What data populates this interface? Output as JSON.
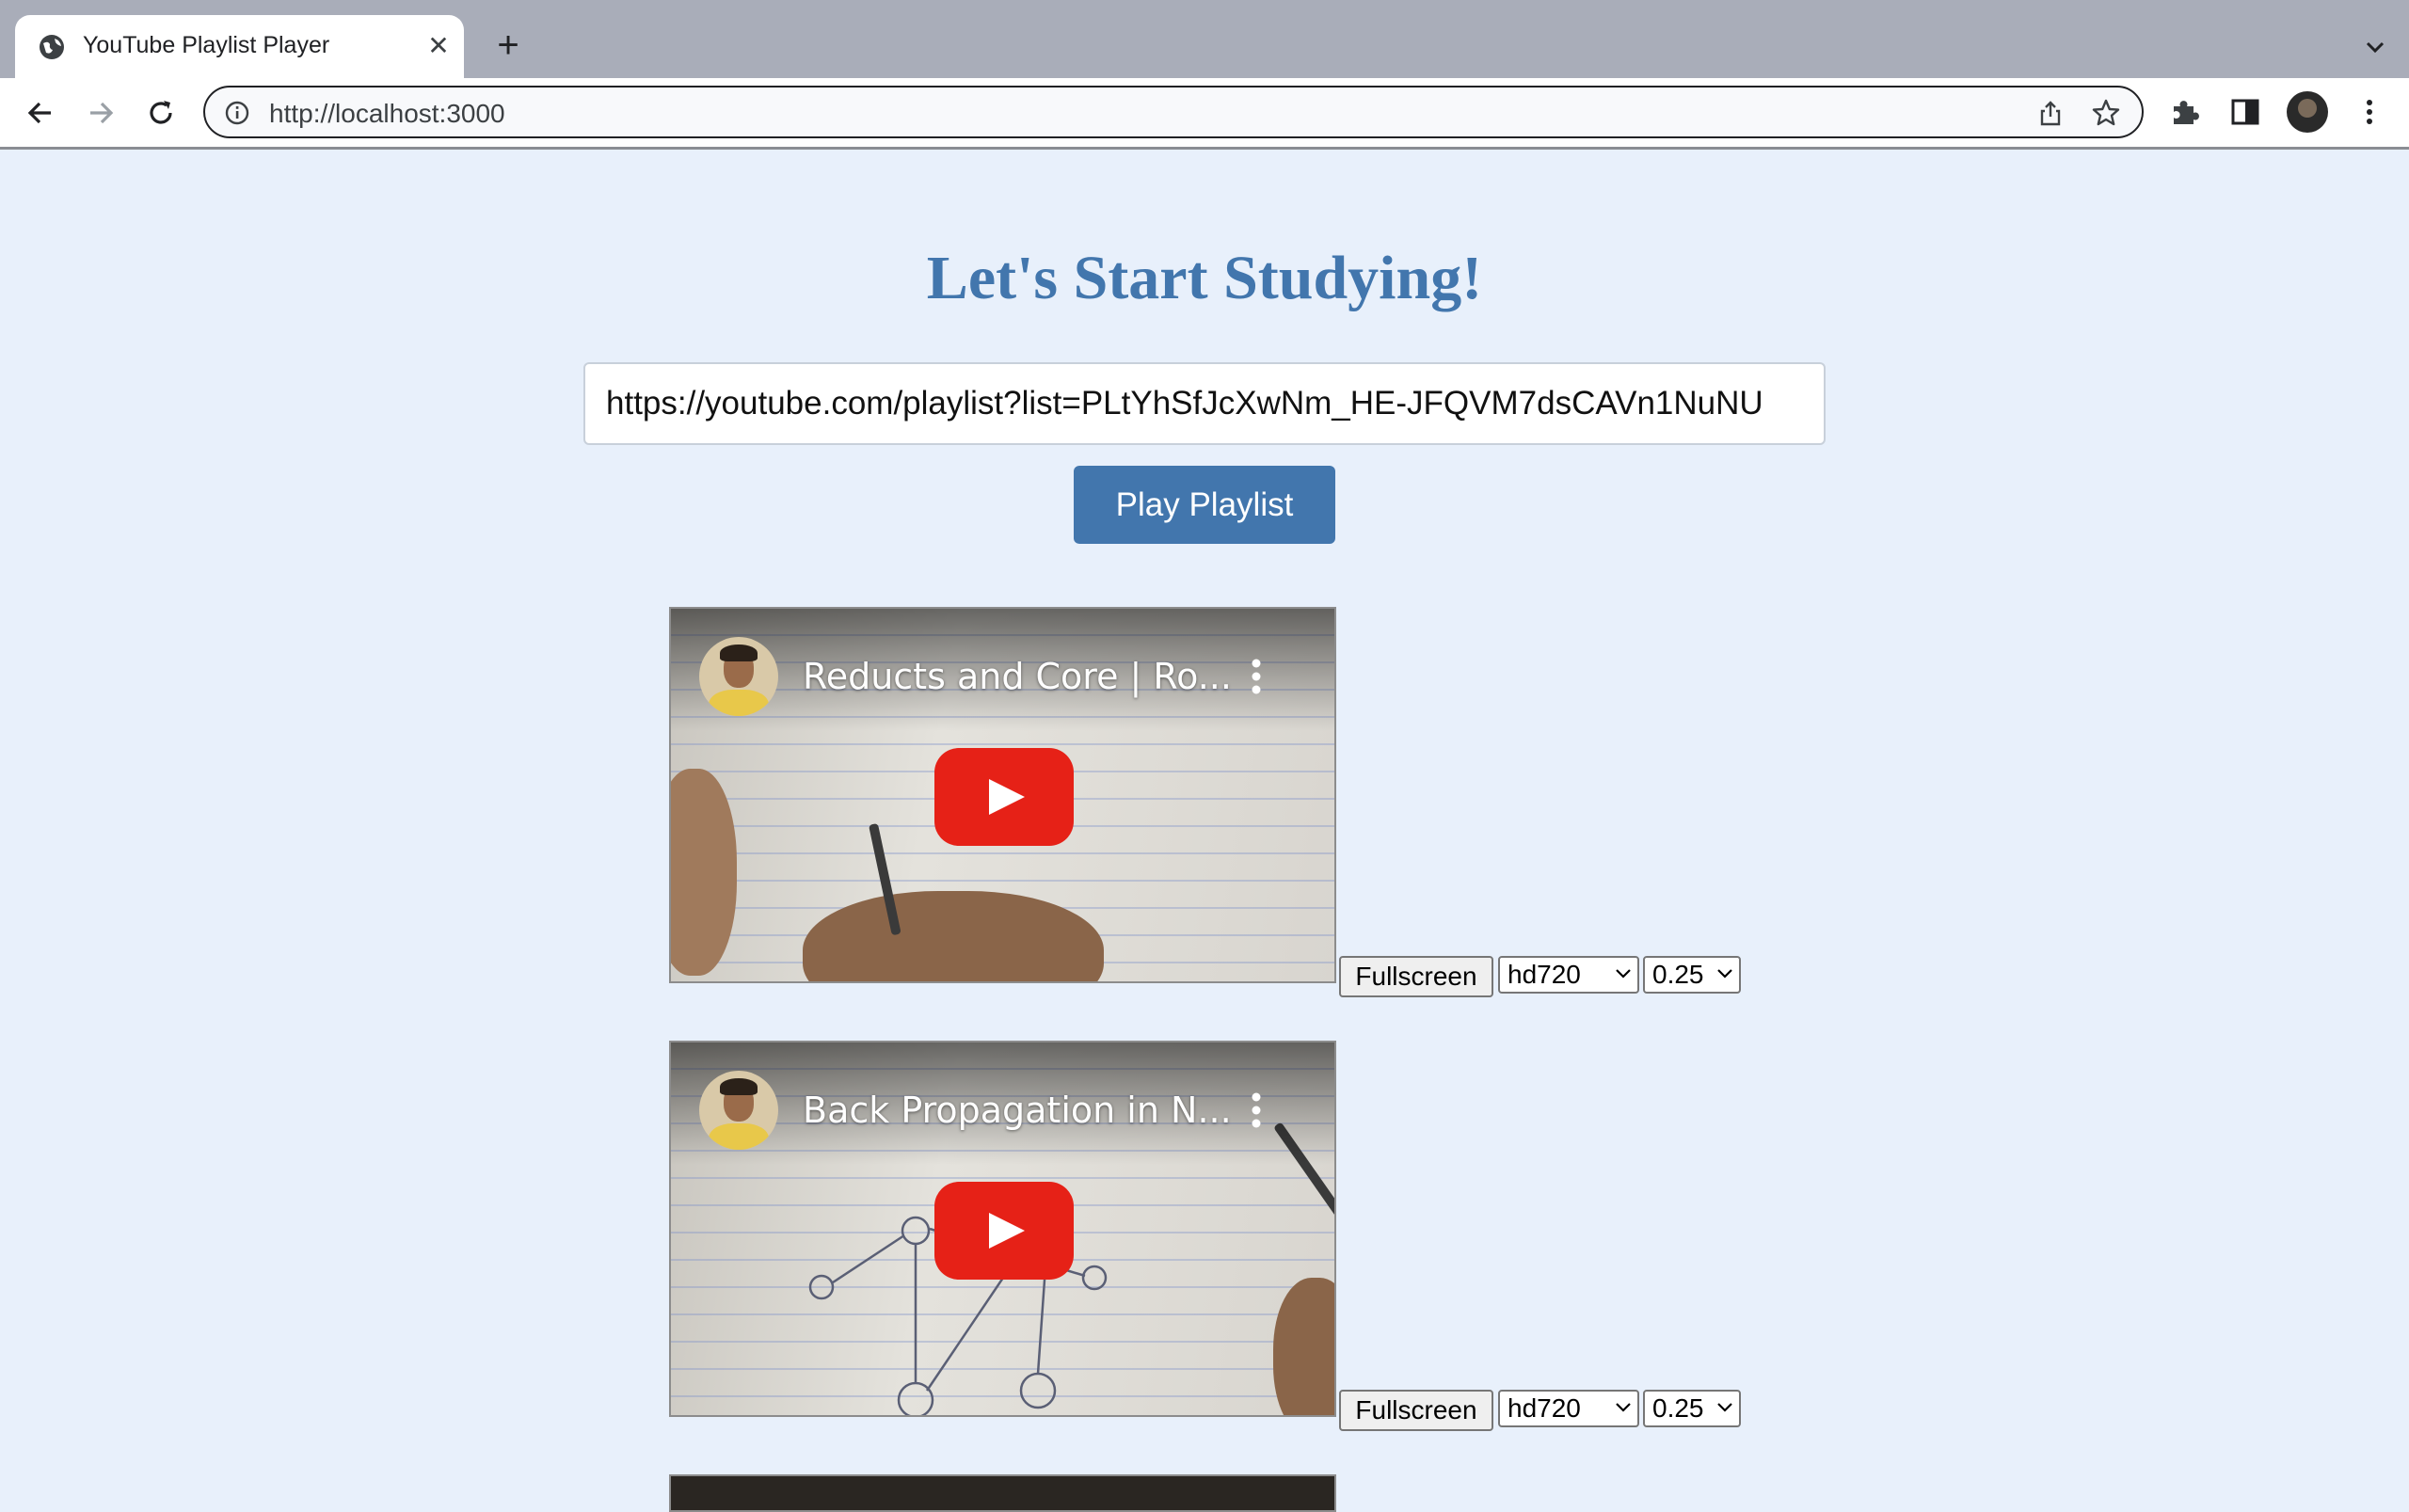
{
  "browser": {
    "tab_title": "YouTube Playlist Player",
    "address": "http://localhost:3000"
  },
  "page": {
    "heading": "Let's Start Studying!",
    "playlist_input_value": "https://youtube.com/playlist?list=PLtYhSfJcXwNm_HE-JFQVM7dsCAVn1NuNU",
    "play_button_label": "Play Playlist"
  },
  "videos": [
    {
      "title": "Reducts and Core | Ro...",
      "fullscreen_label": "Fullscreen",
      "quality": "hd720",
      "speed": "0.25"
    },
    {
      "title": "Back Propagation in N...",
      "fullscreen_label": "Fullscreen",
      "quality": "hd720",
      "speed": "0.25"
    }
  ],
  "colors": {
    "page_bg": "#e8f0fb",
    "accent": "#4276ad",
    "youtube_red": "#e62117"
  }
}
